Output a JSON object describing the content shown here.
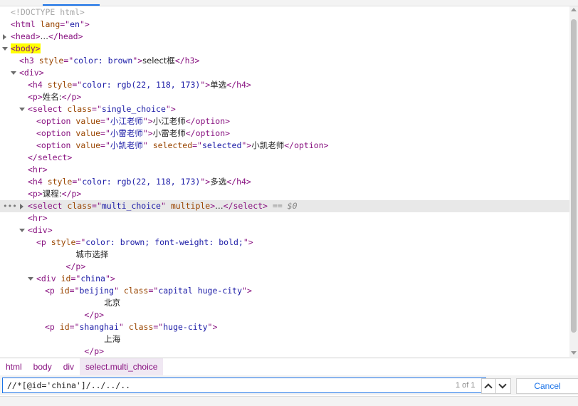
{
  "tree": [
    {
      "depth": 0,
      "toggle": "",
      "parts": [
        [
          "doctype",
          "<!DOCTYPE html>"
        ]
      ]
    },
    {
      "depth": 0,
      "toggle": "",
      "parts": [
        [
          "tag",
          "<html "
        ],
        [
          "attr",
          "lang"
        ],
        [
          "tag",
          "=\""
        ],
        [
          "val",
          "en"
        ],
        [
          "tag",
          "\">"
        ]
      ]
    },
    {
      "depth": 0,
      "toggle": "closed",
      "parts": [
        [
          "tag",
          "<head>"
        ],
        [
          "txt",
          "…"
        ],
        [
          "tag",
          "</head>"
        ]
      ]
    },
    {
      "depth": 0,
      "toggle": "open",
      "parts": [
        [
          "hl",
          "<body>"
        ]
      ]
    },
    {
      "depth": 1,
      "toggle": "",
      "parts": [
        [
          "tag",
          "<h3 "
        ],
        [
          "attr",
          "style"
        ],
        [
          "tag",
          "=\""
        ],
        [
          "val",
          "color: brown"
        ],
        [
          "tag",
          "\">"
        ],
        [
          "txt",
          "select框"
        ],
        [
          "tag",
          "</h3>"
        ]
      ]
    },
    {
      "depth": 1,
      "toggle": "open",
      "parts": [
        [
          "tag",
          "<div>"
        ]
      ]
    },
    {
      "depth": 2,
      "toggle": "",
      "parts": [
        [
          "tag",
          "<h4 "
        ],
        [
          "attr",
          "style"
        ],
        [
          "tag",
          "=\""
        ],
        [
          "val",
          "color: rgb(22, 118, 173)"
        ],
        [
          "tag",
          "\">"
        ],
        [
          "txt",
          "单选"
        ],
        [
          "tag",
          "</h4>"
        ]
      ]
    },
    {
      "depth": 2,
      "toggle": "",
      "parts": [
        [
          "tag",
          "<p>"
        ],
        [
          "txt",
          "姓名:"
        ],
        [
          "tag",
          "</p>"
        ]
      ]
    },
    {
      "depth": 2,
      "toggle": "open",
      "parts": [
        [
          "tag",
          "<select "
        ],
        [
          "attr",
          "class"
        ],
        [
          "tag",
          "=\""
        ],
        [
          "val",
          "single_choice"
        ],
        [
          "tag",
          "\">"
        ]
      ]
    },
    {
      "depth": 3,
      "toggle": "",
      "parts": [
        [
          "tag",
          "<option "
        ],
        [
          "attr",
          "value"
        ],
        [
          "tag",
          "=\""
        ],
        [
          "val",
          "小江老师"
        ],
        [
          "tag",
          "\">"
        ],
        [
          "txt",
          "小江老师"
        ],
        [
          "tag",
          "</option>"
        ]
      ]
    },
    {
      "depth": 3,
      "toggle": "",
      "parts": [
        [
          "tag",
          "<option "
        ],
        [
          "attr",
          "value"
        ],
        [
          "tag",
          "=\""
        ],
        [
          "val",
          "小雷老师"
        ],
        [
          "tag",
          "\">"
        ],
        [
          "txt",
          "小雷老师"
        ],
        [
          "tag",
          "</option>"
        ]
      ]
    },
    {
      "depth": 3,
      "toggle": "",
      "parts": [
        [
          "tag",
          "<option "
        ],
        [
          "attr",
          "value"
        ],
        [
          "tag",
          "=\""
        ],
        [
          "val",
          "小凯老师"
        ],
        [
          "tag",
          "\" "
        ],
        [
          "attr",
          "selected"
        ],
        [
          "tag",
          "=\""
        ],
        [
          "val",
          "selected"
        ],
        [
          "tag",
          "\">"
        ],
        [
          "txt",
          "小凯老师"
        ],
        [
          "tag",
          "</option>"
        ]
      ]
    },
    {
      "depth": 2,
      "toggle": "",
      "parts": [
        [
          "tag",
          "</select>"
        ]
      ]
    },
    {
      "depth": 2,
      "toggle": "",
      "parts": [
        [
          "tag",
          "<hr>"
        ]
      ]
    },
    {
      "depth": 2,
      "toggle": "",
      "parts": [
        [
          "tag",
          "<h4 "
        ],
        [
          "attr",
          "style"
        ],
        [
          "tag",
          "=\""
        ],
        [
          "val",
          "color: rgb(22, 118, 173)"
        ],
        [
          "tag",
          "\">"
        ],
        [
          "txt",
          "多选"
        ],
        [
          "tag",
          "</h4>"
        ]
      ]
    },
    {
      "depth": 2,
      "toggle": "",
      "parts": [
        [
          "tag",
          "<p>"
        ],
        [
          "txt",
          "课程:"
        ],
        [
          "tag",
          "</p>"
        ]
      ]
    },
    {
      "depth": 2,
      "toggle": "closed",
      "selected": true,
      "parts": [
        [
          "tag",
          "<select "
        ],
        [
          "attr",
          "class"
        ],
        [
          "tag",
          "=\""
        ],
        [
          "val",
          "multi_choice"
        ],
        [
          "tag",
          "\" "
        ],
        [
          "attr",
          "multiple"
        ],
        [
          "tag",
          ">"
        ],
        [
          "txt",
          "…"
        ],
        [
          "tag",
          "</select>"
        ],
        [
          "dollar",
          " == $0"
        ]
      ]
    },
    {
      "depth": 2,
      "toggle": "",
      "parts": [
        [
          "tag",
          "<hr>"
        ]
      ]
    },
    {
      "depth": 2,
      "toggle": "open",
      "parts": [
        [
          "tag",
          "<div>"
        ]
      ]
    },
    {
      "depth": 3,
      "toggle": "",
      "parts": [
        [
          "tag",
          "<p "
        ],
        [
          "attr",
          "style"
        ],
        [
          "tag",
          "=\""
        ],
        [
          "val",
          "color: brown; font-weight: bold;"
        ],
        [
          "tag",
          "\">"
        ]
      ]
    },
    {
      "depth": 3,
      "toggle": "",
      "raw": "        ",
      "parts": [
        [
          "txt",
          "城市选择"
        ]
      ]
    },
    {
      "depth": 3,
      "toggle": "",
      "raw": "      ",
      "parts": [
        [
          "tag",
          "</p>"
        ]
      ]
    },
    {
      "depth": 3,
      "toggle": "open",
      "parts": [
        [
          "tag",
          "<div "
        ],
        [
          "attr",
          "id"
        ],
        [
          "tag",
          "=\""
        ],
        [
          "val",
          "china"
        ],
        [
          "tag",
          "\">"
        ]
      ]
    },
    {
      "depth": 4,
      "toggle": "",
      "parts": [
        [
          "tag",
          "<p "
        ],
        [
          "attr",
          "id"
        ],
        [
          "tag",
          "=\""
        ],
        [
          "val",
          "beijing"
        ],
        [
          "tag",
          "\" "
        ],
        [
          "attr",
          "class"
        ],
        [
          "tag",
          "=\""
        ],
        [
          "val",
          "capital huge-city"
        ],
        [
          "tag",
          "\">"
        ]
      ]
    },
    {
      "depth": 4,
      "toggle": "",
      "raw": "            ",
      "parts": [
        [
          "txt",
          "北京"
        ]
      ]
    },
    {
      "depth": 4,
      "toggle": "",
      "raw": "        ",
      "parts": [
        [
          "tag",
          "</p>"
        ]
      ]
    },
    {
      "depth": 4,
      "toggle": "",
      "parts": [
        [
          "tag",
          "<p "
        ],
        [
          "attr",
          "id"
        ],
        [
          "tag",
          "=\""
        ],
        [
          "val",
          "shanghai"
        ],
        [
          "tag",
          "\" "
        ],
        [
          "attr",
          "class"
        ],
        [
          "tag",
          "=\""
        ],
        [
          "val",
          "huge-city"
        ],
        [
          "tag",
          "\">"
        ]
      ]
    },
    {
      "depth": 4,
      "toggle": "",
      "raw": "            ",
      "parts": [
        [
          "txt",
          "上海"
        ]
      ]
    },
    {
      "depth": 4,
      "toggle": "",
      "raw": "        ",
      "parts": [
        [
          "tag",
          "</p>"
        ]
      ]
    }
  ],
  "breadcrumbs": [
    {
      "label": "html"
    },
    {
      "label": "body"
    },
    {
      "label": "div"
    },
    {
      "label": "select.multi_choice",
      "active": true
    }
  ],
  "search": {
    "value": "//*[@id='china']/../../..",
    "match_count": "1 of 1",
    "cancel_label": "Cancel"
  },
  "icons": {
    "expand": "triangle-right-icon",
    "collapse": "triangle-down-icon",
    "prev": "chevron-up-icon",
    "next": "chevron-down-icon"
  }
}
